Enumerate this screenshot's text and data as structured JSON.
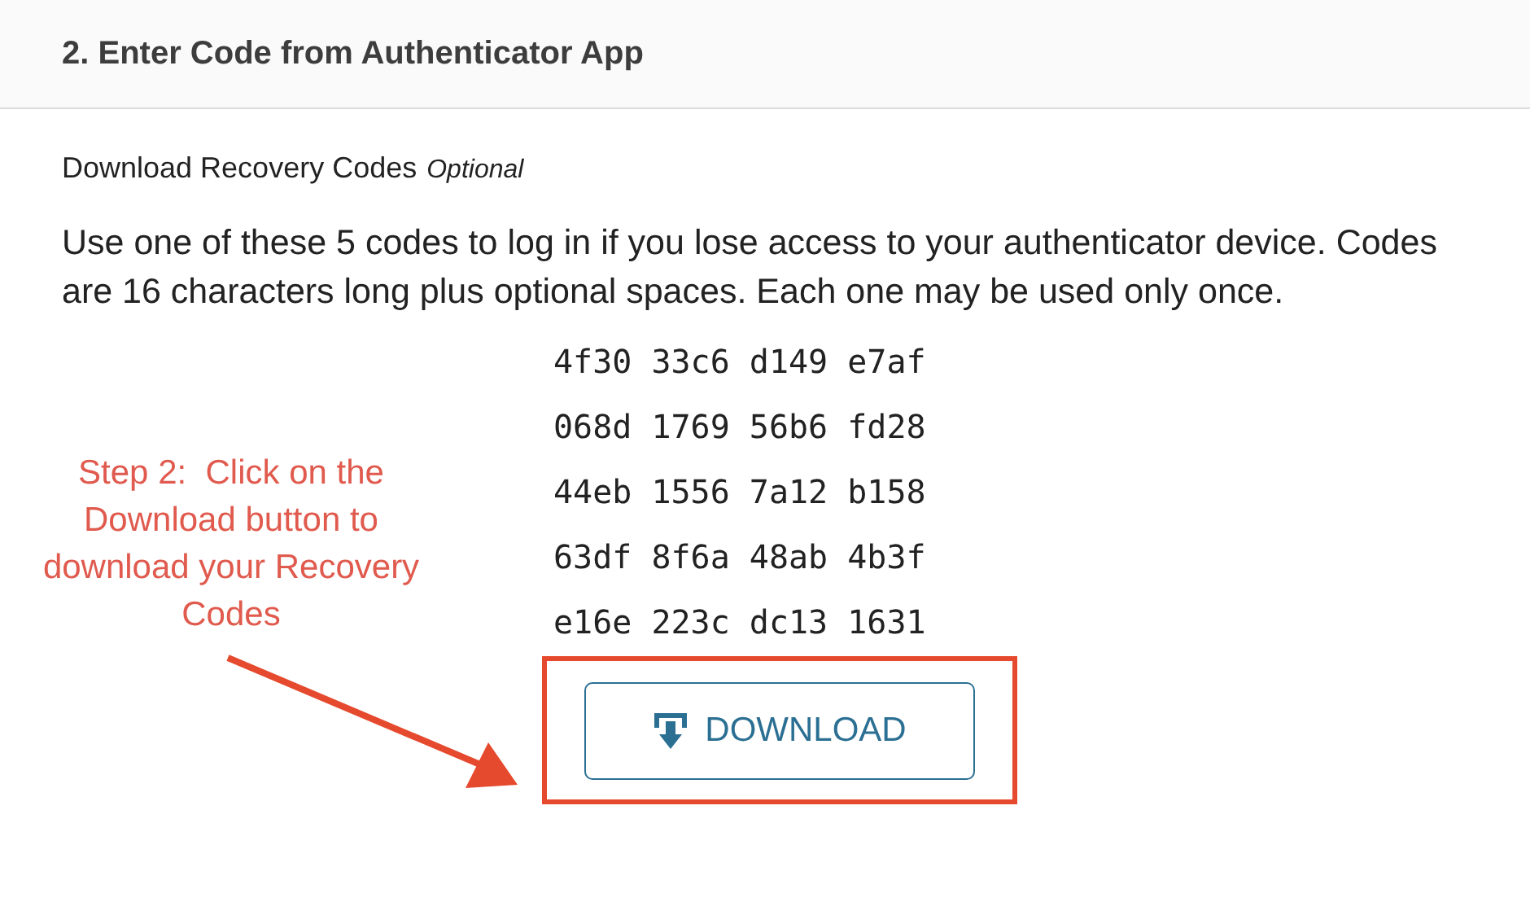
{
  "header": {
    "title": "2. Enter Code from Authenticator App"
  },
  "section": {
    "title": "Download Recovery Codes",
    "tag": "Optional"
  },
  "description": "Use one of these 5 codes to log in if you lose access to your authenticator device. Codes are 16 characters long plus optional spaces. Each one may be used only once.",
  "codes": [
    "4f30 33c6 d149 e7af",
    "068d 1769 56b6 fd28",
    "44eb 1556 7a12 b158",
    "63df 8f6a 48ab 4b3f",
    "e16e 223c dc13 1631"
  ],
  "download_button": {
    "label": "DOWNLOAD",
    "highlighted": true
  },
  "annotation": {
    "text": "Step 2:  Click on the Download button to download your Recovery Codes"
  }
}
